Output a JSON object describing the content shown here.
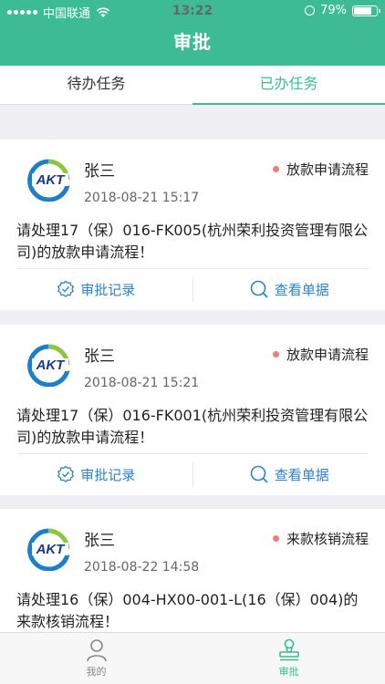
{
  "status": {
    "carrier": "中国联通",
    "time": "13:22",
    "battery": "79%",
    "battery_level": 0.79
  },
  "header": {
    "title": "审批"
  },
  "tabs": [
    {
      "label": "待办任务",
      "active": false
    },
    {
      "label": "已办任务",
      "active": true
    }
  ],
  "tasks": [
    {
      "name": "张三",
      "process": "放款申请流程",
      "time": "2018-08-21 15:17",
      "description": "请处理17（保）016-FK005(杭州荣利投资管理有限公司)的放款申请流程！"
    },
    {
      "name": "张三",
      "process": "放款申请流程",
      "time": "2018-08-21 15:21",
      "description": "请处理17（保）016-FK001(杭州荣利投资管理有限公司)的放款申请流程！"
    },
    {
      "name": "张三",
      "process": "来款核销流程",
      "time": "2018-08-22 14:58",
      "description": "请处理16（保）004-HX00-001-L(16（保）004)的来款核销流程！"
    }
  ],
  "actions": {
    "record": "审批记录",
    "view": "查看单据"
  },
  "logo_text": "AKT",
  "nav": [
    {
      "label": "我的",
      "icon": "person-icon",
      "active": false
    },
    {
      "label": "审批",
      "icon": "stamp-icon",
      "active": true
    }
  ],
  "colors": {
    "primary": "#3dbb95",
    "link": "#2f82c7",
    "dot": "#f17a7a"
  }
}
